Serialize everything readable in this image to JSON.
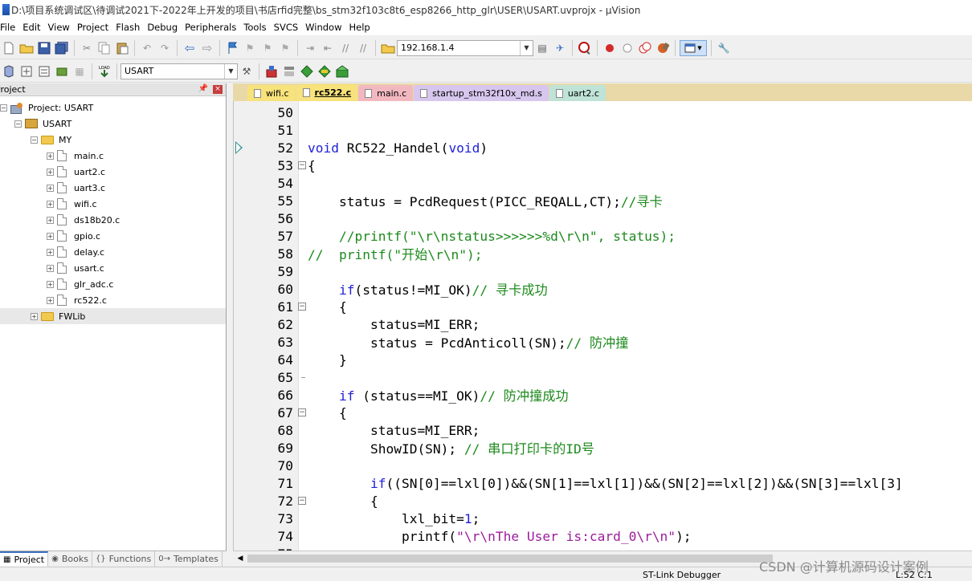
{
  "window": {
    "title": "D:\\项目系统调试区\\待调试2021下-2022年上开发的项目\\书店rfid完整\\bs_stm32f103c8t6_esp8266_http_glr\\USER\\USART.uvprojx - µVision"
  },
  "menu": [
    "File",
    "Edit",
    "View",
    "Project",
    "Flash",
    "Debug",
    "Peripherals",
    "Tools",
    "SVCS",
    "Window",
    "Help"
  ],
  "toolbar1": {
    "address_value": "192.168.1.4"
  },
  "toolbar2": {
    "target_value": "USART"
  },
  "project_panel": {
    "title": "Project",
    "pin_glyph": "📌",
    "close_glyph": "×",
    "tree": [
      {
        "label": "Project: USART",
        "type": "project",
        "level": 0,
        "expanded": true
      },
      {
        "label": "USART",
        "type": "target",
        "level": 1,
        "expanded": true
      },
      {
        "label": "MY",
        "type": "folder",
        "level": 2,
        "expanded": true
      },
      {
        "label": "main.c",
        "type": "file",
        "level": 3
      },
      {
        "label": "uart2.c",
        "type": "file",
        "level": 3
      },
      {
        "label": "uart3.c",
        "type": "file",
        "level": 3
      },
      {
        "label": "wifi.c",
        "type": "file",
        "level": 3
      },
      {
        "label": "ds18b20.c",
        "type": "file",
        "level": 3
      },
      {
        "label": "gpio.c",
        "type": "file",
        "level": 3
      },
      {
        "label": "delay.c",
        "type": "file",
        "level": 3
      },
      {
        "label": "usart.c",
        "type": "file",
        "level": 3
      },
      {
        "label": "glr_adc.c",
        "type": "file",
        "level": 3
      },
      {
        "label": "rc522.c",
        "type": "file",
        "level": 3
      },
      {
        "label": "FWLib",
        "type": "folder",
        "level": 2,
        "expanded": false,
        "selected": true
      }
    ]
  },
  "panel_tabs": [
    {
      "label": "Project",
      "icon": "▦",
      "active": true
    },
    {
      "label": "Books",
      "icon": "◉",
      "active": false
    },
    {
      "label": "Functions",
      "icon": "{}",
      "active": false
    },
    {
      "label": "Templates",
      "icon": "0→",
      "active": false
    }
  ],
  "editor_tabs": [
    {
      "label": "wifi.c",
      "color": "#f7e27c",
      "active": false
    },
    {
      "label": "rc522.c",
      "color": "#f7e27c",
      "active": true
    },
    {
      "label": "main.c",
      "color": "#f2b8c0",
      "active": false
    },
    {
      "label": "startup_stm32f10x_md.s",
      "color": "#d7c6ee",
      "active": false
    },
    {
      "label": "uart2.c",
      "color": "#bfe3d6",
      "active": false
    }
  ],
  "code_lines": [
    {
      "n": "50",
      "parts": []
    },
    {
      "n": "51",
      "parts": []
    },
    {
      "n": "52",
      "parts": [
        {
          "t": "kw",
          "v": "void"
        },
        {
          "t": "",
          "v": " RC522_Handel("
        },
        {
          "t": "kw",
          "v": "void"
        },
        {
          "t": "",
          "v": ")"
        }
      ]
    },
    {
      "n": "53",
      "fold": "open",
      "parts": [
        {
          "t": "",
          "v": "{"
        }
      ]
    },
    {
      "n": "54",
      "parts": []
    },
    {
      "n": "55",
      "parts": [
        {
          "t": "",
          "v": "    status = PcdRequest(PICC_REQALL,CT);"
        },
        {
          "t": "cm",
          "v": "//寻卡"
        }
      ]
    },
    {
      "n": "56",
      "parts": []
    },
    {
      "n": "57",
      "parts": [
        {
          "t": "cm",
          "v": "    //printf(\"\\r\\nstatus>>>>>>%d\\r\\n\", status);"
        }
      ]
    },
    {
      "n": "58",
      "parts": [
        {
          "t": "cm",
          "v": "//  printf(\"开始\\r\\n\");"
        }
      ]
    },
    {
      "n": "59",
      "parts": []
    },
    {
      "n": "60",
      "parts": [
        {
          "t": "",
          "v": "    "
        },
        {
          "t": "kw",
          "v": "if"
        },
        {
          "t": "",
          "v": "(status!=MI_OK)"
        },
        {
          "t": "cm",
          "v": "// 寻卡成功"
        }
      ]
    },
    {
      "n": "61",
      "fold": "open",
      "parts": [
        {
          "t": "",
          "v": "    {"
        }
      ]
    },
    {
      "n": "62",
      "parts": [
        {
          "t": "",
          "v": "        status=MI_ERR;"
        }
      ]
    },
    {
      "n": "63",
      "parts": [
        {
          "t": "",
          "v": "        status = PcdAnticoll(SN);"
        },
        {
          "t": "cm",
          "v": "// 防冲撞"
        }
      ]
    },
    {
      "n": "64",
      "parts": [
        {
          "t": "",
          "v": "    }"
        }
      ]
    },
    {
      "n": "65",
      "fold": "tick",
      "parts": []
    },
    {
      "n": "66",
      "parts": [
        {
          "t": "",
          "v": "    "
        },
        {
          "t": "kw",
          "v": "if"
        },
        {
          "t": "",
          "v": " (status==MI_OK)"
        },
        {
          "t": "cm",
          "v": "// 防冲撞成功"
        }
      ]
    },
    {
      "n": "67",
      "fold": "open",
      "parts": [
        {
          "t": "",
          "v": "    {"
        }
      ]
    },
    {
      "n": "68",
      "parts": [
        {
          "t": "",
          "v": "        status=MI_ERR;"
        }
      ]
    },
    {
      "n": "69",
      "parts": [
        {
          "t": "",
          "v": "        ShowID(SN); "
        },
        {
          "t": "cm",
          "v": "// 串口打印卡的ID号"
        }
      ]
    },
    {
      "n": "70",
      "parts": []
    },
    {
      "n": "71",
      "parts": [
        {
          "t": "",
          "v": "        "
        },
        {
          "t": "kw",
          "v": "if"
        },
        {
          "t": "",
          "v": "((SN[0]==lxl[0])&&(SN[1]==lxl[1])&&(SN[2]==lxl[2])&&(SN[3]==lxl[3]"
        }
      ]
    },
    {
      "n": "72",
      "fold": "open",
      "parts": [
        {
          "t": "",
          "v": "        {"
        }
      ]
    },
    {
      "n": "73",
      "parts": [
        {
          "t": "",
          "v": "            lxl_bit="
        },
        {
          "t": "kw",
          "v": "1"
        },
        {
          "t": "",
          "v": ";"
        }
      ]
    },
    {
      "n": "74",
      "parts": [
        {
          "t": "",
          "v": "            printf("
        },
        {
          "t": "st",
          "v": "\"\\r\\nThe User is:card_0\\r\\n\""
        },
        {
          "t": "",
          "v": ");"
        }
      ]
    },
    {
      "n": "75",
      "parts": []
    }
  ],
  "status": {
    "debugger": "ST-Link Debugger",
    "cursor": "L:52 C:1"
  },
  "watermark": "CSDN @计算机源码设计案例"
}
